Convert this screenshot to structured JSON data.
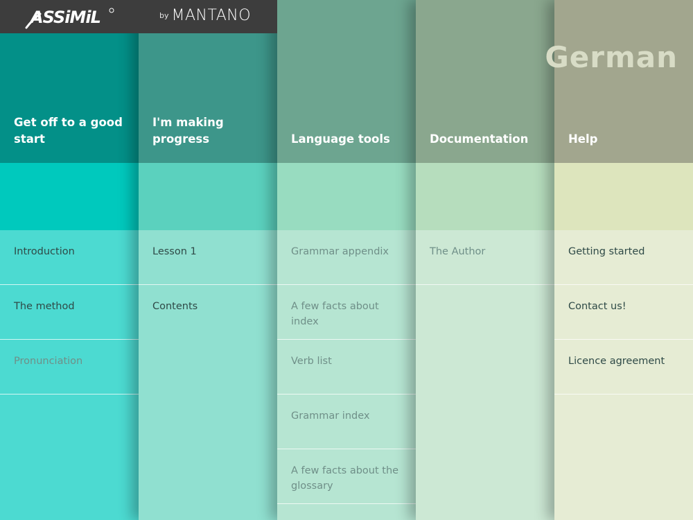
{
  "app": {
    "logo_text": "ASSiMiL",
    "partner_by": "by",
    "partner_name": "MANTANO",
    "language": "German"
  },
  "colors": {
    "topbar": "#3d3d3d",
    "col0": {
      "header": "#039088",
      "band": "#00c9bd",
      "body": "#4cdad1"
    },
    "col1": {
      "header": "#3d968a",
      "band": "#5bd1be",
      "body": "#90e0d0"
    },
    "col2": {
      "header": "#6da590",
      "band": "#98dcc0",
      "body": "#b6e5d2"
    },
    "col3": {
      "header": "#8aa78e",
      "band": "#b6ddbd",
      "body": "#cce8d4"
    },
    "col4": {
      "header": "#a2a68e",
      "band": "#dde5bd",
      "body": "#e6ecd4"
    }
  },
  "columns": [
    {
      "title": "Get off to a good start",
      "items": [
        {
          "label": "Introduction",
          "style": "dark"
        },
        {
          "label": "The method",
          "style": "dark"
        },
        {
          "label": "Pronunciation",
          "style": "dim"
        }
      ]
    },
    {
      "title": "I'm making progress",
      "items": [
        {
          "label": "Lesson 1",
          "style": "dark"
        },
        {
          "label": "Contents",
          "style": "dark"
        }
      ]
    },
    {
      "title": "Language tools",
      "items": [
        {
          "label": "Grammar appendix",
          "style": "dim"
        },
        {
          "label": "A few facts about index",
          "style": "dim"
        },
        {
          "label": "Verb list",
          "style": "dim"
        },
        {
          "label": "Grammar index",
          "style": "dim"
        },
        {
          "label": "A few facts about the glossary",
          "style": "dim"
        }
      ]
    },
    {
      "title": "Documentation",
      "items": [
        {
          "label": "The Author",
          "style": "dim"
        }
      ]
    },
    {
      "title": "Help",
      "items": [
        {
          "label": "Getting started",
          "style": "dark"
        },
        {
          "label": "Contact us!",
          "style": "dark"
        },
        {
          "label": "Licence agreement",
          "style": "dark"
        }
      ]
    }
  ]
}
